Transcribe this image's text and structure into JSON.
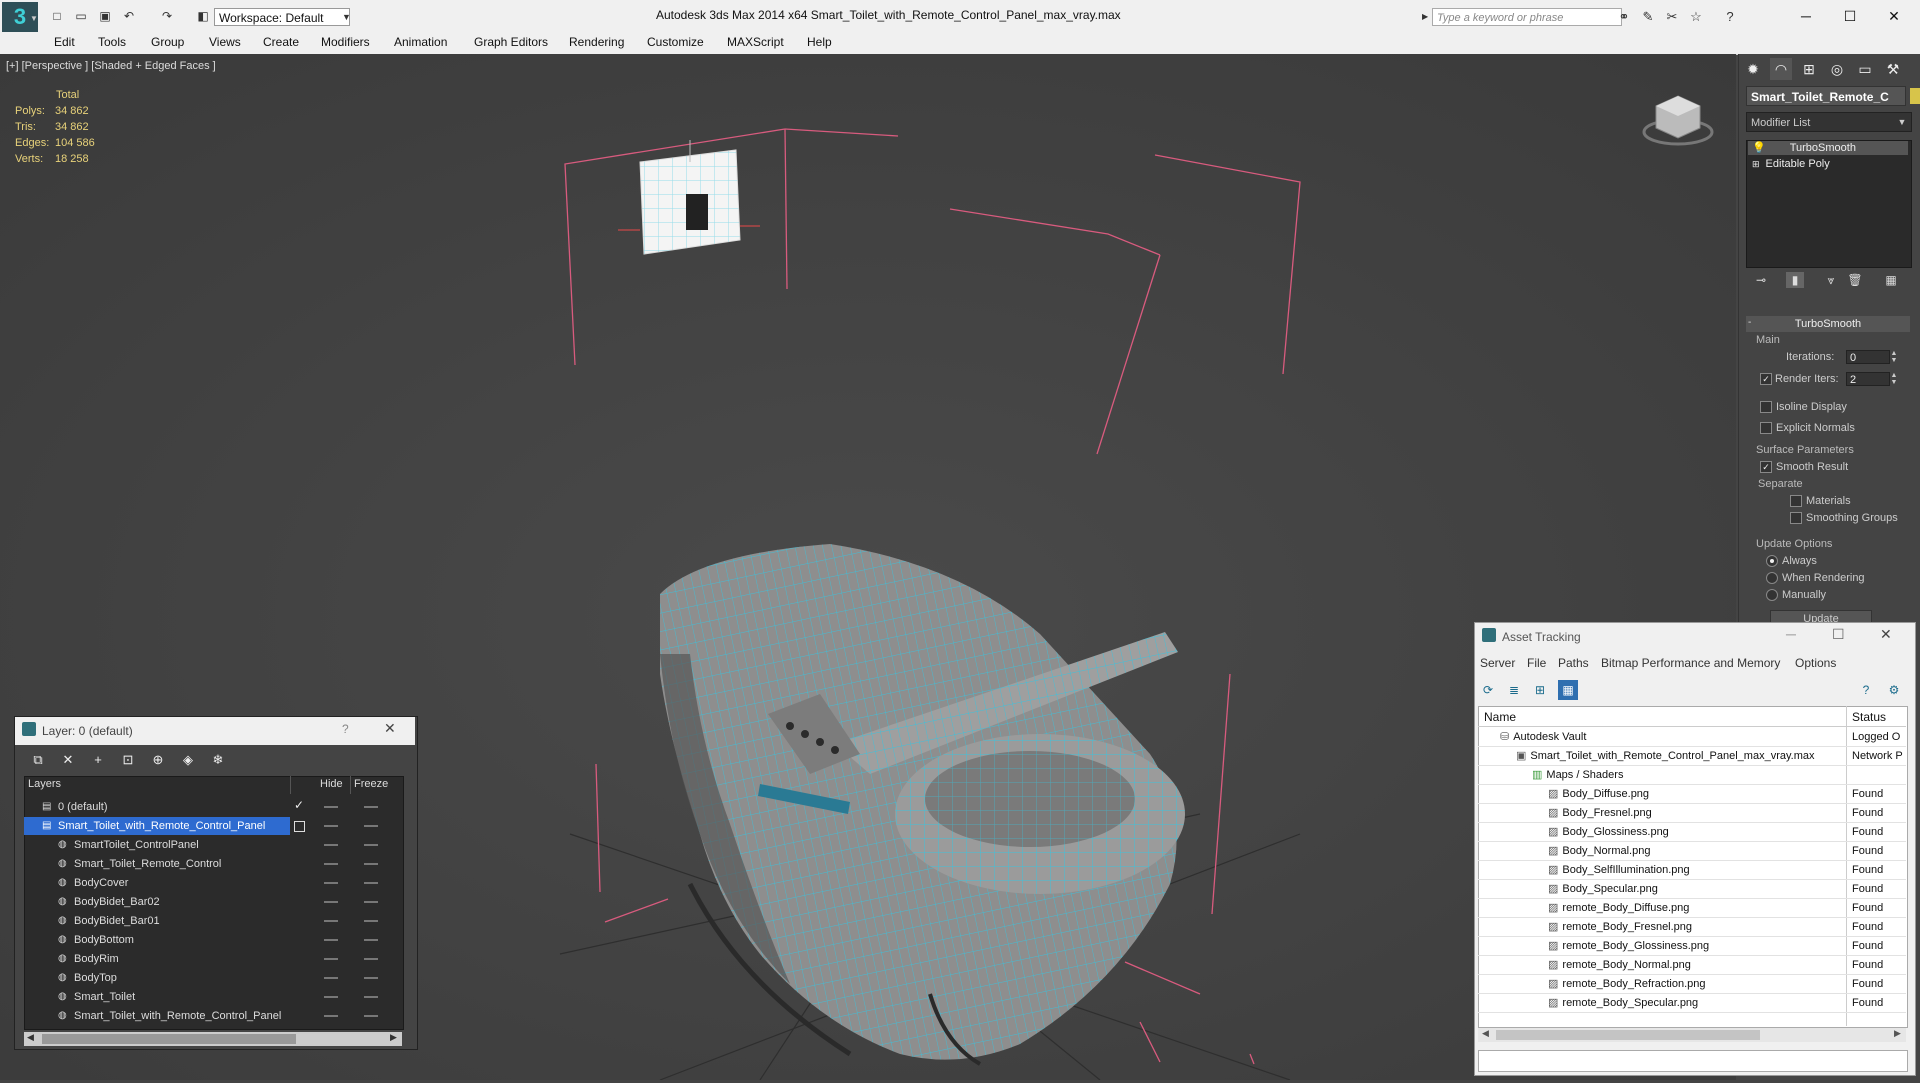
{
  "app": {
    "title": "Autodesk 3ds Max  2014 x64      Smart_Toilet_with_Remote_Control_Panel_max_vray.max",
    "workspace": "Workspace: Default",
    "search_placeholder": "Type a keyword or phrase"
  },
  "menu": [
    "Edit",
    "Tools",
    "Group",
    "Views",
    "Create",
    "Modifiers",
    "Animation",
    "Graph Editors",
    "Rendering",
    "Customize",
    "MAXScript",
    "Help"
  ],
  "viewport": {
    "label": "[+] [Perspective ] [Shaded + Edged Faces ]",
    "stats": {
      "header": "Total",
      "rows": [
        {
          "label": "Polys:",
          "value": "34 862"
        },
        {
          "label": "Tris:",
          "value": "34 862"
        },
        {
          "label": "Edges:",
          "value": "104 586"
        },
        {
          "label": "Verts:",
          "value": "18 258"
        }
      ]
    }
  },
  "command_panel": {
    "object_name": "Smart_Toilet_Remote_C",
    "object_color": "#d7c44a",
    "modifier_list": "Modifier List",
    "stack": [
      "TurboSmooth",
      "Editable Poly"
    ],
    "turbosmooth": {
      "header": "TurboSmooth",
      "main_label": "Main",
      "iterations_label": "Iterations:",
      "iterations_value": "0",
      "render_iters_label": "Render Iters:",
      "render_iters_value": "2",
      "isoline_display": "Isoline Display",
      "explicit_normals": "Explicit Normals",
      "surface_parameters": "Surface Parameters",
      "smooth_result": "Smooth Result",
      "separate": "Separate",
      "materials": "Materials",
      "smoothing_groups": "Smoothing Groups",
      "update_options": "Update Options",
      "always": "Always",
      "when_rendering": "When Rendering",
      "manually": "Manually",
      "update_button": "Update"
    }
  },
  "layer_dialog": {
    "title": "Layer: 0 (default)",
    "help": "?",
    "columns": {
      "layers": "Layers",
      "hide": "Hide",
      "freeze": "Freeze"
    },
    "rows": [
      {
        "name": "0 (default)",
        "level": 1
      },
      {
        "name": "Smart_Toilet_with_Remote_Control_Panel",
        "level": 1,
        "selected": true
      },
      {
        "name": "SmartToilet_ControlPanel",
        "level": 2
      },
      {
        "name": "Smart_Toilet_Remote_Control",
        "level": 2
      },
      {
        "name": "BodyCover",
        "level": 2
      },
      {
        "name": "BodyBidet_Bar02",
        "level": 2
      },
      {
        "name": "BodyBidet_Bar01",
        "level": 2
      },
      {
        "name": "BodyBottom",
        "level": 2
      },
      {
        "name": "BodyRim",
        "level": 2
      },
      {
        "name": "BodyTop",
        "level": 2
      },
      {
        "name": "Smart_Toilet",
        "level": 2
      },
      {
        "name": "Smart_Toilet_with_Remote_Control_Panel",
        "level": 2
      }
    ]
  },
  "asset_tracking": {
    "title": "Asset Tracking",
    "menu": [
      "Server",
      "File",
      "Paths",
      "Bitmap Performance and Memory",
      "Options"
    ],
    "columns": {
      "name": "Name",
      "status": "Status"
    },
    "rows": [
      {
        "name": "Autodesk Vault",
        "status": "Logged O",
        "level": 0
      },
      {
        "name": "Smart_Toilet_with_Remote_Control_Panel_max_vray.max",
        "status": "Network P",
        "level": 1
      },
      {
        "name": "Maps / Shaders",
        "status": "",
        "level": 2
      },
      {
        "name": "Body_Diffuse.png",
        "status": "Found",
        "level": 3
      },
      {
        "name": "Body_Fresnel.png",
        "status": "Found",
        "level": 3
      },
      {
        "name": "Body_Glossiness.png",
        "status": "Found",
        "level": 3
      },
      {
        "name": "Body_Normal.png",
        "status": "Found",
        "level": 3
      },
      {
        "name": "Body_SelfIllumination.png",
        "status": "Found",
        "level": 3
      },
      {
        "name": "Body_Specular.png",
        "status": "Found",
        "level": 3
      },
      {
        "name": "remote_Body_Diffuse.png",
        "status": "Found",
        "level": 3
      },
      {
        "name": "remote_Body_Fresnel.png",
        "status": "Found",
        "level": 3
      },
      {
        "name": "remote_Body_Glossiness.png",
        "status": "Found",
        "level": 3
      },
      {
        "name": "remote_Body_Normal.png",
        "status": "Found",
        "level": 3
      },
      {
        "name": "remote_Body_Refraction.png",
        "status": "Found",
        "level": 3
      },
      {
        "name": "remote_Body_Specular.png",
        "status": "Found",
        "level": 3
      }
    ]
  }
}
